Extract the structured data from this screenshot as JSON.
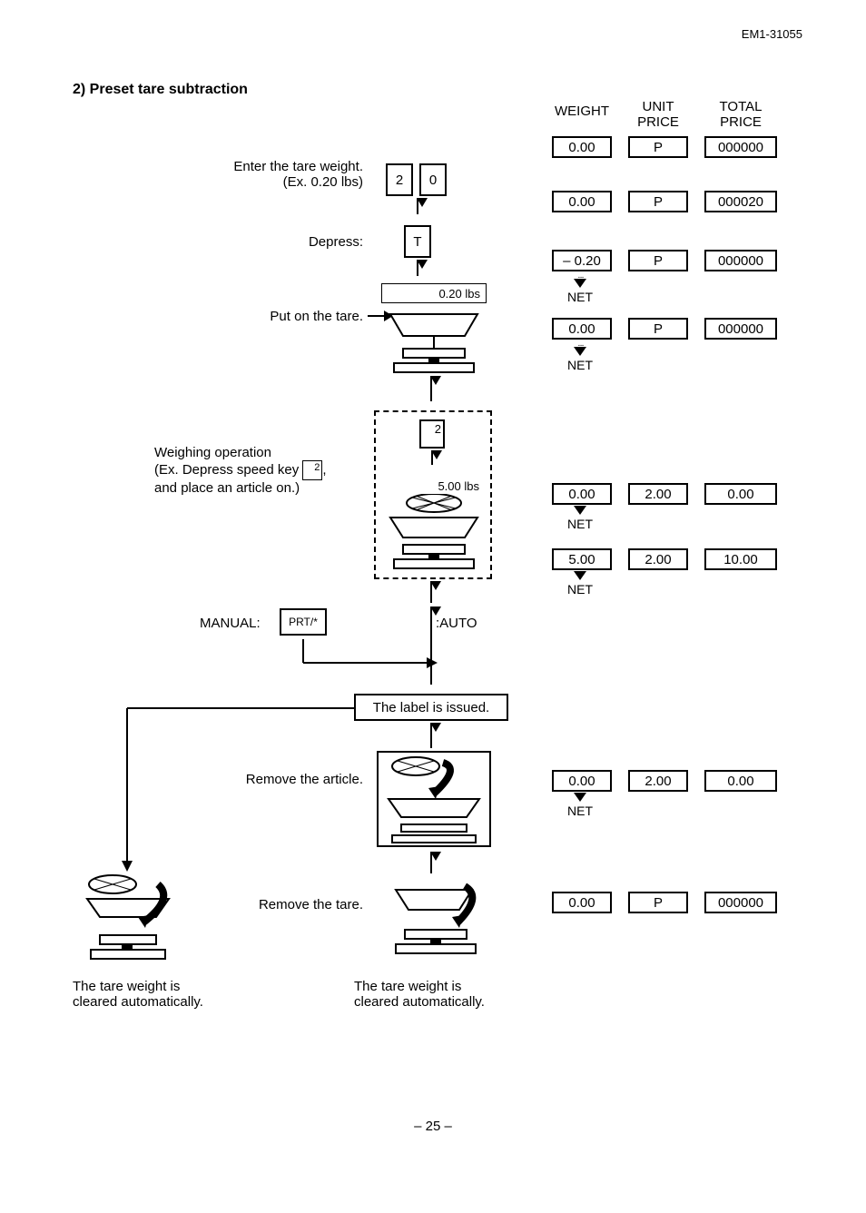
{
  "doc_id": "EM1-31055",
  "section_title": "2) Preset tare subtraction",
  "headers": {
    "weight": "WEIGHT",
    "unit": "UNIT PRICE",
    "total": "TOTAL PRICE"
  },
  "steps": {
    "s1": {
      "label": "Enter the tare weight.\n(Ex. 0.20 lbs)",
      "k1": "2",
      "k2": "0"
    },
    "s2": {
      "label": "Depress:",
      "key": "T"
    },
    "s3": {
      "label": "Put on the tare.",
      "weight_label": "0.20 lbs"
    },
    "s4": {
      "label_l1": "Weighing operation",
      "label_l2_pre": "(Ex. Depress speed key ",
      "speed_key": "2",
      "label_l2_post": ",",
      "label_l3": "and place an article on.)",
      "weight_label": "5.00 lbs",
      "dashed_key": "2"
    },
    "s5": {
      "manual": "MANUAL:",
      "prt": "PRT/*",
      "auto": ":AUTO"
    },
    "s6": {
      "label": "The label is issued."
    },
    "s7": {
      "label": "Remove the article."
    },
    "s8": {
      "label": "Remove the tare."
    },
    "clear_note": "The tare weight is\ncleared automatically."
  },
  "displays": {
    "r1": {
      "w": "0.00",
      "u": "P",
      "t": "000000"
    },
    "r2": {
      "w": "0.00",
      "u": "P",
      "t": "000020"
    },
    "r3": {
      "w": "–  0.20",
      "u": "P",
      "t": "000000",
      "net": "NET"
    },
    "r4": {
      "w": "0.00",
      "u": "P",
      "t": "000000",
      "net": "NET"
    },
    "r5": {
      "w": "0.00",
      "u": "2.00",
      "t": "0.00",
      "net": "NET"
    },
    "r6": {
      "w": "5.00",
      "u": "2.00",
      "t": "10.00",
      "net": "NET"
    },
    "r7": {
      "w": "0.00",
      "u": "2.00",
      "t": "0.00",
      "net": "NET"
    },
    "r8": {
      "w": "0.00",
      "u": "P",
      "t": "000000"
    }
  },
  "page_number": "– 25 –"
}
